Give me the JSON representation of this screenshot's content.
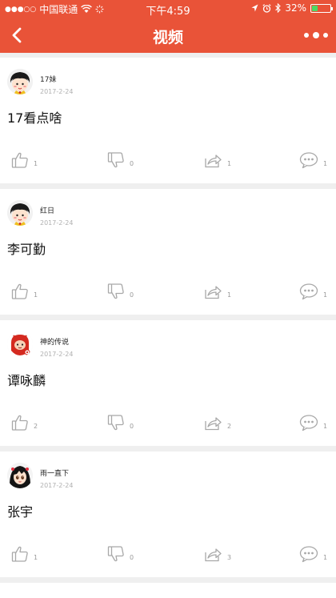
{
  "status_bar": {
    "carrier": "中国联通",
    "time": "下午4:59",
    "battery": "32%",
    "battery_level": 0.32,
    "icons": [
      "signal-dots-icon",
      "wifi-icon",
      "loading-icon",
      "location-icon",
      "alarm-icon",
      "bluetooth-icon",
      "battery-icon"
    ]
  },
  "nav": {
    "title": "视频",
    "back_icon": "chevron-left-icon",
    "more_icon": "more-dots-icon"
  },
  "colors": {
    "accent": "#e95338",
    "background": "#efefef",
    "card": "#ffffff",
    "muted_text": "#9a9a9a",
    "battery_green": "#4cd964"
  },
  "posts": [
    {
      "user": "17妹",
      "date": "2017-2-24",
      "text": "17看点啥",
      "likes": "1",
      "dislikes": "0",
      "shares": "1",
      "comments": "1",
      "avatar": "cartoon-girl-avatar"
    },
    {
      "user": "红日",
      "date": "2017-2-24",
      "text": "李可勤",
      "likes": "1",
      "dislikes": "0",
      "shares": "1",
      "comments": "1",
      "avatar": "cartoon-girl-avatar"
    },
    {
      "user": "神的传说",
      "date": "2017-2-24",
      "text": "谭咏麟",
      "likes": "2",
      "dislikes": "0",
      "shares": "2",
      "comments": "1",
      "avatar": "red-character-avatar"
    },
    {
      "user": "雨一直下",
      "date": "2017-2-24",
      "text": "张宇",
      "likes": "1",
      "dislikes": "0",
      "shares": "3",
      "comments": "1",
      "avatar": "anime-girl-avatar"
    }
  ]
}
